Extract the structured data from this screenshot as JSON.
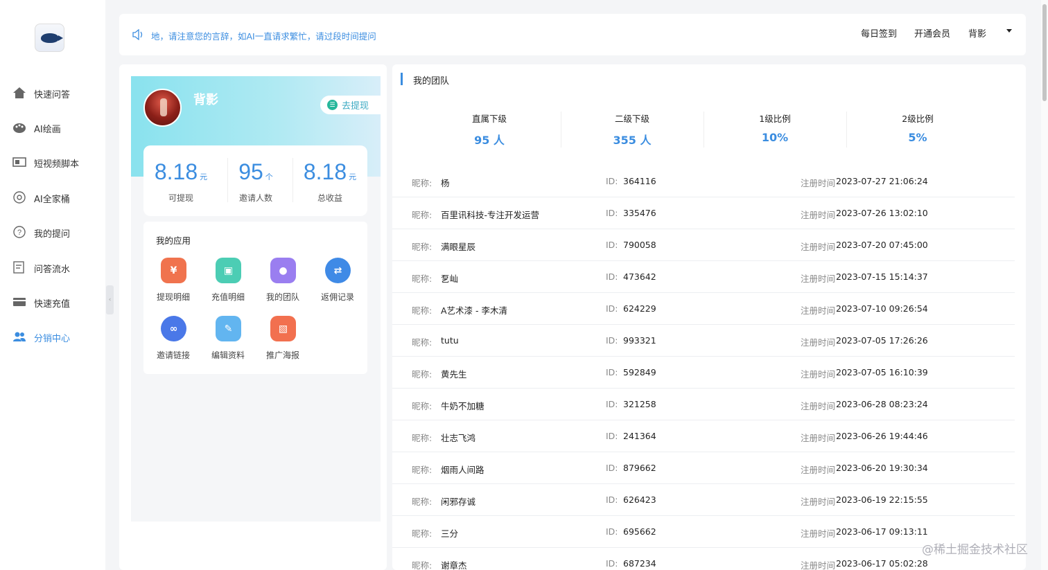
{
  "sidebar": {
    "items": [
      {
        "label": "快速问答",
        "icon": "home-icon"
      },
      {
        "label": "AI绘画",
        "icon": "palette-icon"
      },
      {
        "label": "短视频脚本",
        "icon": "video-icon"
      },
      {
        "label": "AI全家桶",
        "icon": "bucket-icon"
      },
      {
        "label": "我的提问",
        "icon": "question-icon"
      },
      {
        "label": "问答流水",
        "icon": "record-icon"
      },
      {
        "label": "快速充值",
        "icon": "card-icon"
      },
      {
        "label": "分销中心",
        "icon": "team-icon",
        "active": true
      }
    ]
  },
  "topbar": {
    "notice": "地，请注意您的言辞，如AI一直请求繁忙，请过段时间提问",
    "checkin": "每日签到",
    "vip": "开通会员",
    "user": "背影"
  },
  "profile": {
    "name": "背影",
    "withdraw_label": "去提现",
    "stats": [
      {
        "value": "8.18",
        "unit": "元",
        "caption": "可提现"
      },
      {
        "value": "95",
        "unit": "个",
        "caption": "邀请人数"
      },
      {
        "value": "8.18",
        "unit": "元",
        "caption": "总收益"
      }
    ]
  },
  "apps": {
    "title": "我的应用",
    "items": [
      {
        "label": "提现明细",
        "icon": "withdraw-detail-icon",
        "color": "#f0734e",
        "glyph": "¥"
      },
      {
        "label": "充值明细",
        "icon": "recharge-detail-icon",
        "color": "#4ccdb4",
        "glyph": "▣"
      },
      {
        "label": "我的团队",
        "icon": "my-team-icon",
        "color": "#9a7ef0",
        "glyph": "●"
      },
      {
        "label": "返佣记录",
        "icon": "rebate-record-icon",
        "color": "#3f8ae6",
        "glyph": "⇄"
      },
      {
        "label": "邀请链接",
        "icon": "invite-link-icon",
        "color": "#4a78e8",
        "glyph": "∞"
      },
      {
        "label": "编辑资料",
        "icon": "edit-profile-icon",
        "color": "#62b5f0",
        "glyph": "✎"
      },
      {
        "label": "推广海报",
        "icon": "poster-icon",
        "color": "#f2704f",
        "glyph": "▧"
      }
    ]
  },
  "team": {
    "title": "我的团队",
    "stats": [
      {
        "title": "直属下级",
        "value": "95 人"
      },
      {
        "title": "二级下级",
        "value": "355 人"
      },
      {
        "title": "1级比例",
        "value": "10%"
      },
      {
        "title": "2级比例",
        "value": "5%"
      }
    ],
    "nick_key": "昵称:",
    "id_key": "ID:",
    "reg_key": "注册时间",
    "members": [
      {
        "nick": "杨",
        "id": "364116",
        "time": "2023-07-27 21:06:24"
      },
      {
        "nick": "百里讯科技-专注开发运营",
        "id": "335476",
        "time": "2023-07-26 13:02:10"
      },
      {
        "nick": "满眼星辰",
        "id": "790058",
        "time": "2023-07-20 07:45:00"
      },
      {
        "nick": "乭屾",
        "id": "473642",
        "time": "2023-07-15 15:14:37"
      },
      {
        "nick": "A艺术漆 - 李木清",
        "id": "624229",
        "time": "2023-07-10 09:26:54"
      },
      {
        "nick": "tutu",
        "id": "993321",
        "time": "2023-07-05 17:26:26"
      },
      {
        "nick": "黄先生",
        "id": "592849",
        "time": "2023-07-05 16:10:39"
      },
      {
        "nick": "牛奶不加糖",
        "id": "321258",
        "time": "2023-06-28 08:23:24"
      },
      {
        "nick": "壮志飞鸿",
        "id": "241364",
        "time": "2023-06-26 19:44:46"
      },
      {
        "nick": "烟雨人间路",
        "id": "879662",
        "time": "2023-06-20 19:30:34"
      },
      {
        "nick": "闲邪存诚",
        "id": "626423",
        "time": "2023-06-19 22:15:55"
      },
      {
        "nick": "三分",
        "id": "695662",
        "time": "2023-06-17 09:13:11"
      },
      {
        "nick": "谢章杰",
        "id": "687234",
        "time": "2023-06-17 05:02:28"
      }
    ]
  },
  "watermark": "@稀土掘金技术社区",
  "colors": {
    "accent": "#3b8de0",
    "banner": "#89e2ee"
  }
}
